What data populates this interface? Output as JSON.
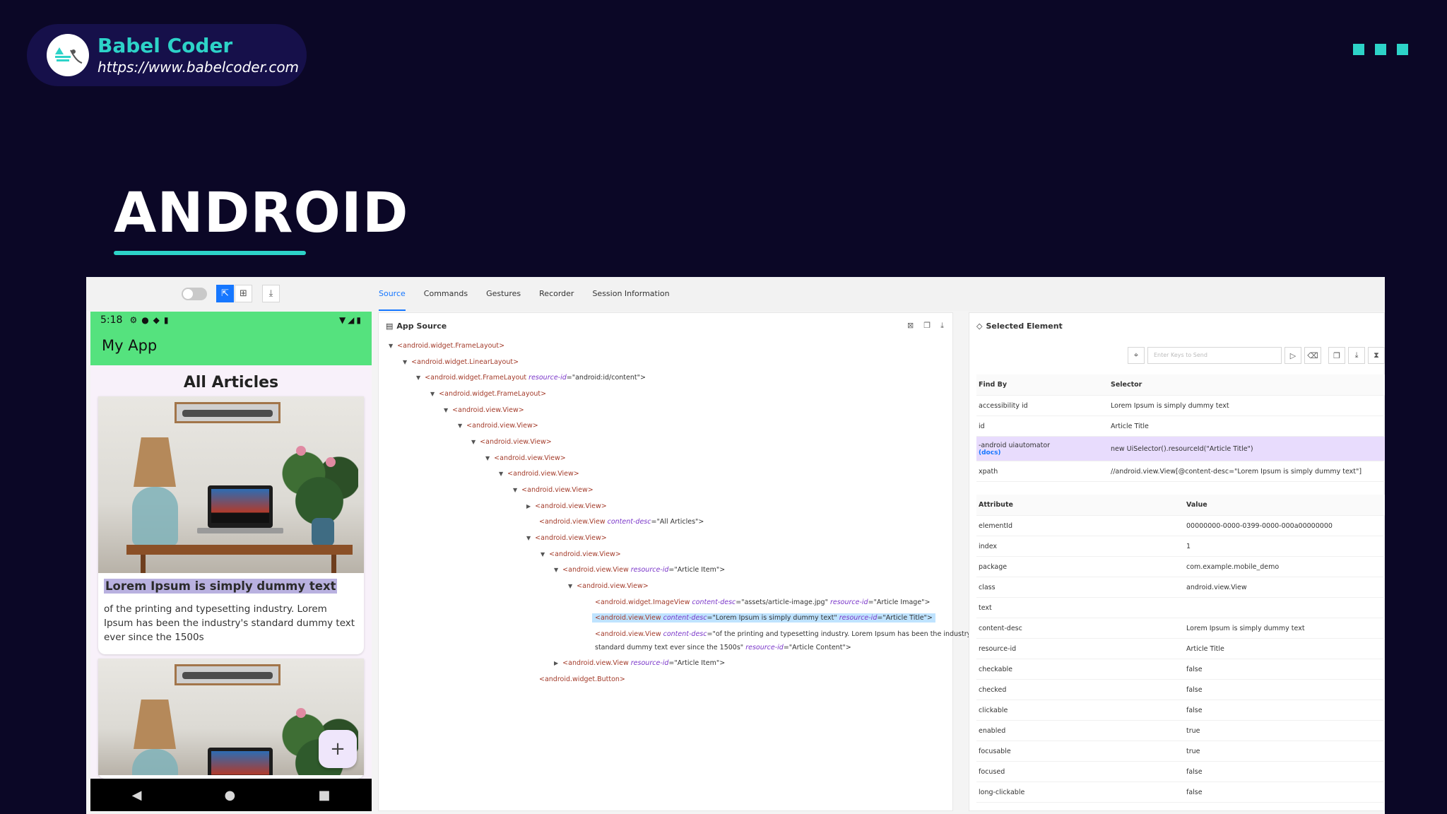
{
  "brand": {
    "name": "Babel Coder",
    "url": "https://www.babelcoder.com"
  },
  "title": "ANDROID",
  "colors": {
    "background": "#0b0726",
    "accent": "#2dd3c8",
    "phone_green": "#55e27e",
    "selection": "#1677ff"
  },
  "toolbar": {
    "icons": [
      "toggle-switch",
      "select-icon",
      "expand-icon",
      "download-icon"
    ]
  },
  "tabs": [
    {
      "label": "Source",
      "active": true
    },
    {
      "label": "Commands"
    },
    {
      "label": "Gestures"
    },
    {
      "label": "Recorder"
    },
    {
      "label": "Session Information"
    }
  ],
  "phone": {
    "time": "5:18",
    "app_title": "My App",
    "heading": "All Articles",
    "card_title": "Lorem Ipsum is simply dummy text",
    "card_body": "of the printing and typesetting industry. Lorem Ipsum has been the industry's standard dummy text ever since the 1500s",
    "fab": "+",
    "nav": [
      "◀",
      "●",
      "■"
    ]
  },
  "source": {
    "title": "App Source",
    "nodes": [
      {
        "text": "<android.widget.FrameLayout>"
      },
      {
        "text": "<android.widget.LinearLayout>"
      },
      {
        "pre": "<android.widget.FrameLayout ",
        "a1": "resource-id",
        "v1": "=\"android:id/content\">"
      },
      {
        "text": "<android.widget.FrameLayout>"
      },
      {
        "text": "<android.view.View>"
      },
      {
        "text": "<android.view.View>"
      },
      {
        "text": "<android.view.View>"
      },
      {
        "text": "<android.view.View>"
      },
      {
        "text": "<android.view.View>"
      },
      {
        "text": "<android.view.View>"
      },
      {
        "text": "<android.view.View>"
      },
      {
        "pre": "<android.view.View ",
        "a1": "content-desc",
        "v1": "=\"All Articles\">"
      },
      {
        "text": "<android.view.View>"
      },
      {
        "text": "<android.view.View>"
      },
      {
        "pre": "<android.view.View ",
        "a1": "resource-id",
        "v1": "=\"Article Item\">"
      },
      {
        "text": "<android.view.View>"
      },
      {
        "pre": "<android.widget.ImageView ",
        "a1": "content-desc",
        "v1": "=\"assets/article-image.jpg\" ",
        "a2": "resource-id",
        "v2": "=\"Article Image\">"
      },
      {
        "pre": "<android.view.View ",
        "a1": "content-desc",
        "v1": "=\"Lorem Ipsum is simply dummy text\" ",
        "a2": "resource-id",
        "v2": "=\"Article Title\">"
      },
      {
        "pre": "<android.view.View ",
        "a1": "content-desc",
        "v1": "=\"of the printing and typesetting industry. Lorem Ipsum has been the industry's"
      },
      {
        "pre": "standard dummy text ever since the 1500s\" ",
        "a1": "resource-id",
        "v1": "=\"Article Content\">"
      },
      {
        "pre": "<android.view.View ",
        "a1": "resource-id",
        "v1": "=\"Article Item\">"
      },
      {
        "text": "<android.widget.Button>"
      }
    ]
  },
  "selected": {
    "title": "Selected Element",
    "keys_placeholder": "Enter Keys to Send",
    "find_by": {
      "headers": [
        "Find By",
        "Selector"
      ],
      "rows": [
        {
          "by": "accessibility id",
          "selector": "Lorem Ipsum is simply dummy text"
        },
        {
          "by": "id",
          "selector": "Article Title"
        },
        {
          "by": "-android uiautomator",
          "docs": "(docs)",
          "selector": "new UiSelector().resourceId(\"Article Title\")"
        },
        {
          "by": "xpath",
          "selector": "//android.view.View[@content-desc=\"Lorem Ipsum is simply dummy text\"]"
        }
      ]
    },
    "attributes": {
      "headers": [
        "Attribute",
        "Value"
      ],
      "rows": [
        {
          "name": "elementId",
          "value": "00000000-0000-0399-0000-000a00000000"
        },
        {
          "name": "index",
          "value": "1"
        },
        {
          "name": "package",
          "value": "com.example.mobile_demo"
        },
        {
          "name": "class",
          "value": "android.view.View"
        },
        {
          "name": "text",
          "value": ""
        },
        {
          "name": "content-desc",
          "value": "Lorem Ipsum is simply dummy text"
        },
        {
          "name": "resource-id",
          "value": "Article Title"
        },
        {
          "name": "checkable",
          "value": "false"
        },
        {
          "name": "checked",
          "value": "false"
        },
        {
          "name": "clickable",
          "value": "false"
        },
        {
          "name": "enabled",
          "value": "true"
        },
        {
          "name": "focusable",
          "value": "true"
        },
        {
          "name": "focused",
          "value": "false"
        },
        {
          "name": "long-clickable",
          "value": "false"
        }
      ]
    }
  }
}
